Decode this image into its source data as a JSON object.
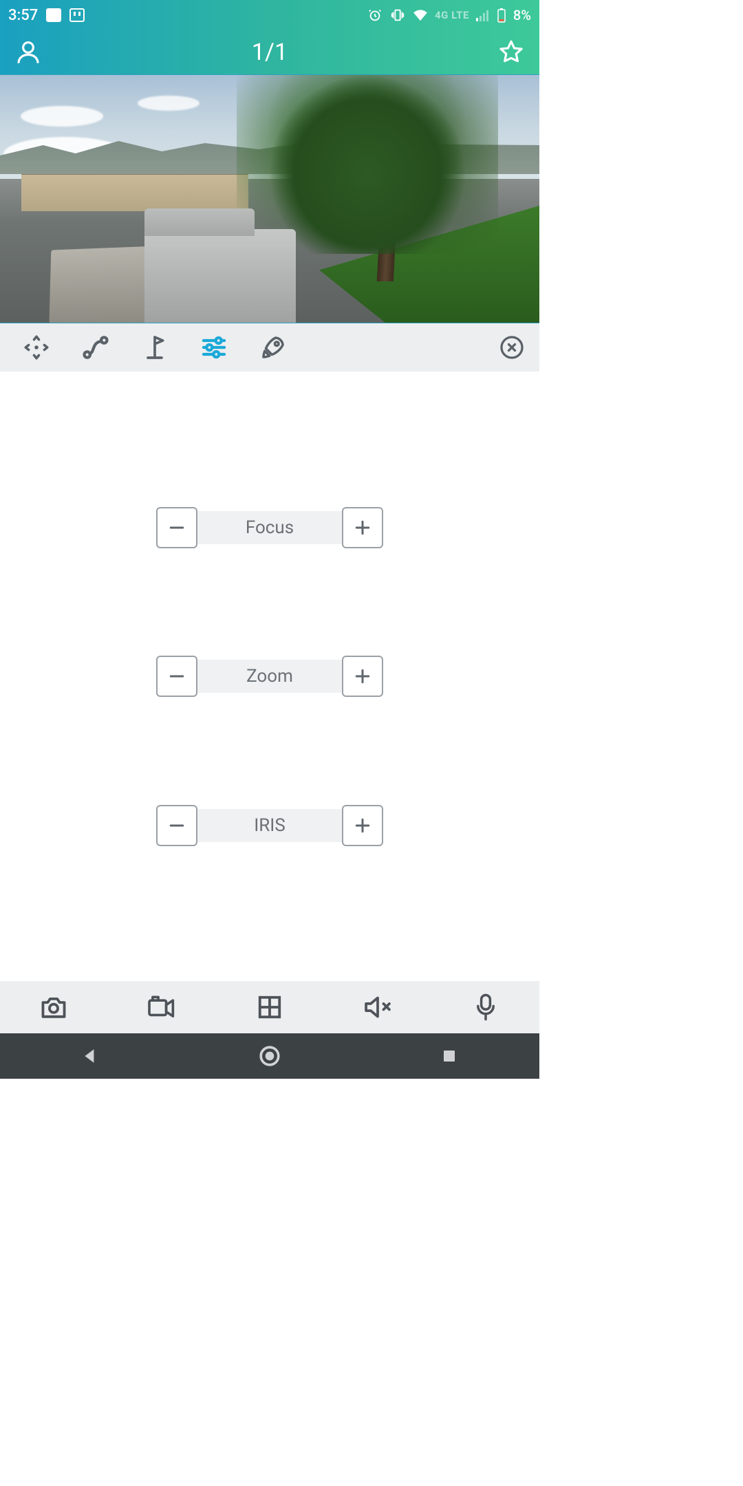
{
  "status": {
    "time": "3:57",
    "network_label": "4G LTE",
    "battery_pct": "8%"
  },
  "app": {
    "title": "1/1"
  },
  "toolbar_icons": [
    "ptz-move-icon",
    "path-icon",
    "flag-icon",
    "sliders-icon",
    "rocket-icon"
  ],
  "controls": [
    {
      "label": "Focus"
    },
    {
      "label": "Zoom"
    },
    {
      "label": "IRIS"
    }
  ],
  "bottom_icons": [
    "camera-icon",
    "video-icon",
    "grid-icon",
    "mute-icon",
    "mic-icon"
  ]
}
